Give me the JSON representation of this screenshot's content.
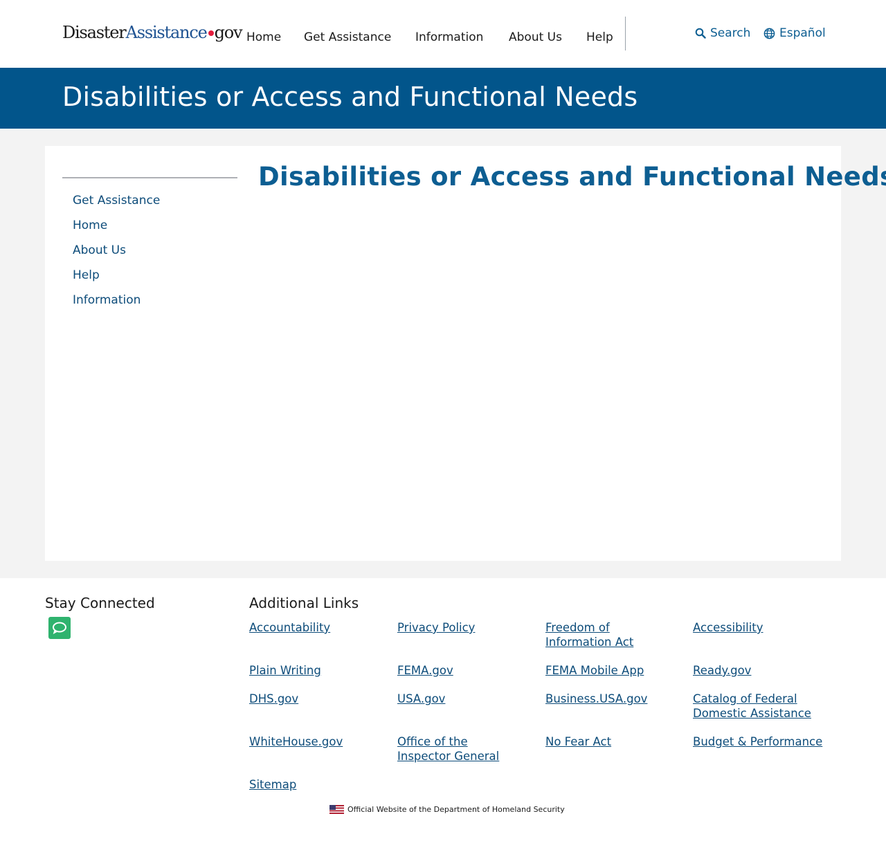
{
  "header": {
    "logo": {
      "part1": "Disaster",
      "part2": "Assistance",
      "part3": "gov"
    },
    "nav": [
      "Home",
      "Get Assistance",
      "Information",
      "About Us",
      "Help"
    ],
    "search_label": "Search",
    "language_label": "Español"
  },
  "banner": {
    "title": "Disabilities or Access and Functional Needs"
  },
  "sidebar": {
    "items": [
      "Get Assistance",
      "Home",
      "About Us",
      "Help",
      "Information"
    ]
  },
  "main": {
    "title": "Disabilities or Access and Functional Needs"
  },
  "footer": {
    "stay_connected": "Stay Connected",
    "additional_links_title": "Additional Links",
    "links": [
      "Accountability",
      "Privacy Policy",
      "Freedom of Information Act",
      "Accessibility",
      "Plain Writing",
      "FEMA.gov",
      "FEMA Mobile App",
      "Ready.gov",
      "DHS.gov",
      "USA.gov",
      "Business.USA.gov",
      "Catalog of Federal Domestic Assistance",
      "WhiteHouse.gov",
      "Office of the Inspector General",
      "No Fear Act",
      "Budget & Performance",
      "Sitemap"
    ],
    "official_text": "Official Website of the Department of Homeland Security"
  },
  "colors": {
    "brand_blue": "#02558b",
    "link_blue": "#0d4c7a",
    "accent_red": "#e31c3d",
    "chat_green": "#2fb36e"
  }
}
